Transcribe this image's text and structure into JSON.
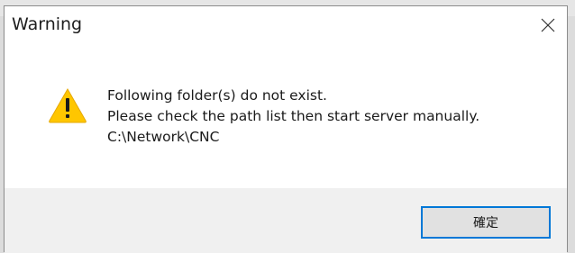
{
  "window": {
    "title": "Warning"
  },
  "icons": {
    "warning": "warning-triangle-icon",
    "close": "close-icon"
  },
  "message": {
    "lines": [
      "Following folder(s) do not exist.",
      "Please check the path list then start server manually.",
      "C:\\Network\\CNC"
    ]
  },
  "buttons": {
    "ok_label": "確定"
  },
  "colors": {
    "accent": "#0078d7",
    "warning_fill": "#ffc600",
    "footer_bg": "#f0f0f0"
  }
}
